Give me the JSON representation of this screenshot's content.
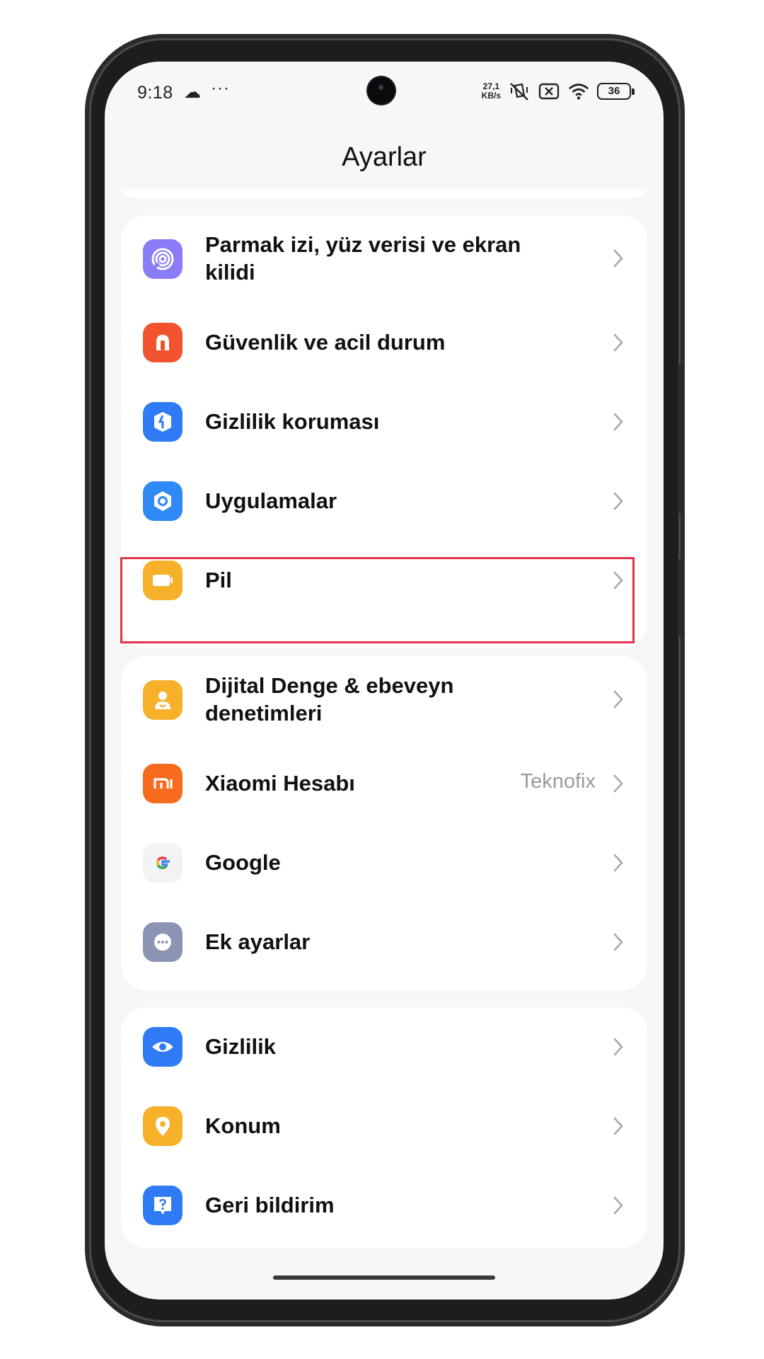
{
  "status_bar": {
    "time": "9:18",
    "cloud_icon": "☁",
    "dots": "···",
    "net_speed_value": "27,1",
    "net_speed_unit": "KB/s",
    "battery": "36"
  },
  "page_title": "Ayarlar",
  "groups": [
    {
      "items": [
        {
          "label_line1": "Parmak izi, yüz verisi ve ekran",
          "label_line2": "kilidi",
          "icon": "fingerprint-icon",
          "color": "#8a7cf7"
        },
        {
          "label": "Güvenlik ve acil durum",
          "icon": "alarm-icon",
          "color": "#f2522e"
        },
        {
          "label": "Gizlilik koruması",
          "icon": "shield-icon",
          "color": "#2f7bf5"
        },
        {
          "label": "Uygulamalar",
          "icon": "hexagon-gear-icon",
          "color": "#2f8af5"
        },
        {
          "label": "Pil",
          "icon": "battery-icon",
          "color": "#f7b02a",
          "highlighted": true
        }
      ]
    },
    {
      "items": [
        {
          "label_line1": "Dijital Denge & ebeveyn",
          "label_line2": "denetimleri",
          "icon": "parental-icon",
          "color": "#f7b02a"
        },
        {
          "label": "Xiaomi Hesabı",
          "value": "Teknofix",
          "icon": "mi-icon",
          "color": "#f76b1c"
        },
        {
          "label": "Google",
          "icon": "google-icon",
          "color": "#f1f3f4"
        },
        {
          "label": "Ek ayarlar",
          "icon": "more-dots-icon",
          "color": "#8c94b4"
        }
      ]
    },
    {
      "items": [
        {
          "label": "Gizlilik",
          "icon": "eye-icon",
          "color": "#2f7bf5"
        },
        {
          "label": "Konum",
          "icon": "location-pin-icon",
          "color": "#f7b02a"
        },
        {
          "label": "Geri bildirim",
          "icon": "feedback-icon",
          "color": "#2f7bf5"
        }
      ]
    }
  ]
}
